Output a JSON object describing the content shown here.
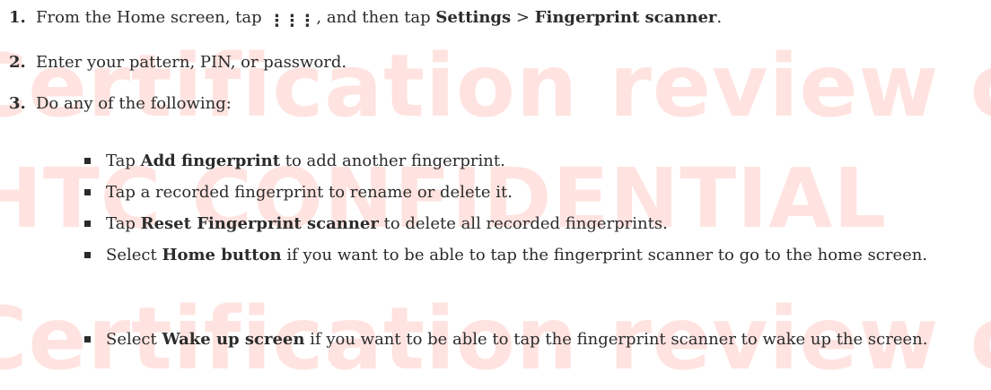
{
  "watermark": {
    "line1": "Certification review on",
    "line2": "HTC CONFIDENTIAL",
    "line3": "Certification review on"
  },
  "steps": [
    {
      "number": "1.",
      "part1": "From the Home screen, tap",
      "icon": "apps-grid-icon",
      "part2": ", and then tap",
      "bold1": "Settings",
      "sep": ">",
      "bold2": "Fingerprint scanner",
      "end": "."
    },
    {
      "number": "2.",
      "text": "Enter your pattern, PIN, or password."
    },
    {
      "number": "3.",
      "text": "Do any of the following:"
    }
  ],
  "bullets": [
    {
      "pre": "Tap",
      "bold": "Add fingerprint",
      "post": "to add another fingerprint."
    },
    {
      "text": "Tap a recorded fingerprint to rename or delete it."
    },
    {
      "pre": "Tap",
      "bold": "Reset Fingerprint scanner",
      "post": "to delete all recorded fingerprints."
    },
    {
      "pre": "Select",
      "bold": "Home button",
      "post": "if you want to be able to tap the fingerprint scanner to go to the home screen."
    },
    {
      "pre": "Select",
      "bold": "Wake up screen",
      "post": "if you want to be able to tap the fingerprint scanner to wake up the screen."
    }
  ]
}
